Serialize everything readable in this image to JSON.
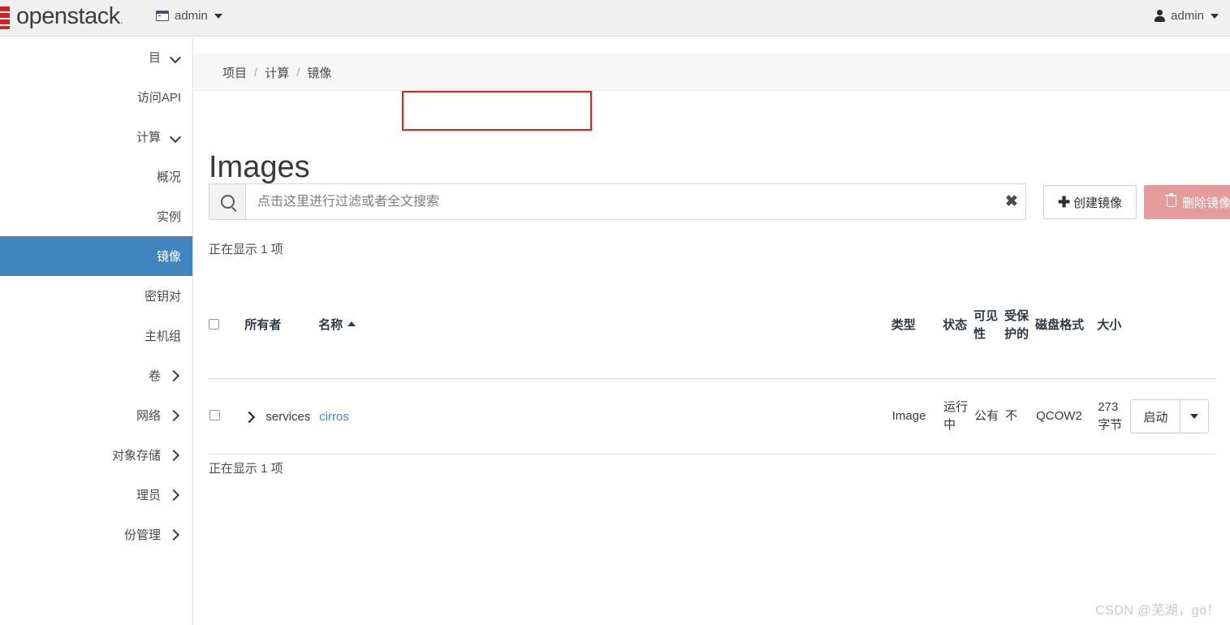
{
  "topbar": {
    "logo_text": "openstack",
    "logo_dot": ".",
    "tenant_label": "admin",
    "user_label": "admin"
  },
  "sidebar": {
    "items": [
      {
        "label": "目",
        "type": "group",
        "icon": "chevron-down-icon",
        "active": false
      },
      {
        "label": "访问API",
        "type": "child",
        "icon": "",
        "active": false
      },
      {
        "label": "计算",
        "type": "group",
        "icon": "chevron-down-icon",
        "active": false
      },
      {
        "label": "概况",
        "type": "child",
        "icon": "",
        "active": false
      },
      {
        "label": "实例",
        "type": "child",
        "icon": "",
        "active": false
      },
      {
        "label": "镜像",
        "type": "child",
        "icon": "",
        "active": true
      },
      {
        "label": "密钥对",
        "type": "child",
        "icon": "",
        "active": false
      },
      {
        "label": "主机组",
        "type": "child",
        "icon": "",
        "active": false
      },
      {
        "label": "卷",
        "type": "group",
        "icon": "chevron-right-icon",
        "active": false
      },
      {
        "label": "网络",
        "type": "group",
        "icon": "chevron-right-icon",
        "active": false
      },
      {
        "label": "对象存储",
        "type": "group",
        "icon": "chevron-right-icon",
        "active": false
      },
      {
        "label": "理员",
        "type": "group",
        "icon": "chevron-right-icon",
        "active": false
      },
      {
        "label": "份管理",
        "type": "group",
        "icon": "chevron-right-icon",
        "active": false
      }
    ]
  },
  "breadcrumb": {
    "items": [
      "项目",
      "计算",
      "镜像"
    ],
    "separator": "/"
  },
  "page": {
    "title": "Images"
  },
  "search": {
    "placeholder": "点击这里进行过滤或者全文搜索",
    "value": "",
    "clear_label": "✖",
    "icon": "search-icon"
  },
  "toolbar": {
    "create_label": "创建镜像",
    "create_plus": "✚",
    "delete_label": "删除镜像",
    "delete_icon": "trash-icon"
  },
  "table": {
    "count_top": "正在显示 1 项",
    "count_bottom": "正在显示 1 项",
    "headers": {
      "select": "",
      "owner": "所有者",
      "name": "名称",
      "name_sort": "ascending",
      "type": "类型",
      "status": "状态",
      "visibility": "可见性",
      "protected": "受保护的",
      "disk_format": "磁盘格式",
      "size": "大小",
      "actions": ""
    },
    "rows": [
      {
        "owner": "services",
        "name": "cirros",
        "type": "Image",
        "status": "运行中",
        "visibility": "公有",
        "protected": "不",
        "disk_format": "QCOW2",
        "size": "273 字节",
        "action_label": "启动"
      }
    ]
  },
  "watermark": "CSDN @芜湖，go！",
  "colors": {
    "active_nav": "#4085bd",
    "annotation": "#f01a1a",
    "link": "#4a86c7",
    "danger": "#e08a8a",
    "logo_red": "#cc2229"
  }
}
